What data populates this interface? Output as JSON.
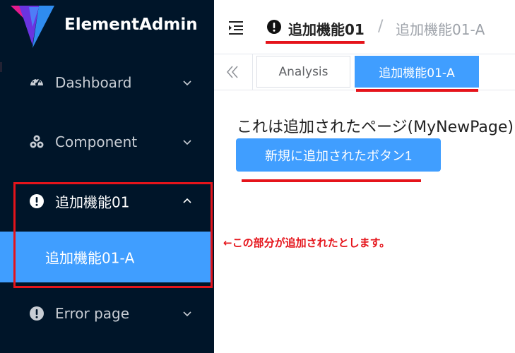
{
  "app": {
    "title": "ElementAdmin"
  },
  "sidebar": {
    "items": [
      {
        "label": "Dashboard",
        "icon": "dashboard-icon"
      },
      {
        "label": "Component",
        "icon": "component-icon"
      },
      {
        "label": "追加機能01",
        "icon": "warning-circle-icon",
        "open": true,
        "children": [
          {
            "label": "追加機能01-A",
            "active": true
          }
        ]
      },
      {
        "label": "Error page",
        "icon": "warning-circle-icon"
      }
    ]
  },
  "header": {
    "breadcrumb": {
      "current": "追加機能01",
      "separator": "/",
      "next": "追加機能01-A"
    }
  },
  "tabs": [
    {
      "label": "Analysis",
      "active": false
    },
    {
      "label": "追加機能01-A",
      "active": true
    }
  ],
  "content": {
    "text": "これは追加されたページ(MyNewPage)",
    "button_label": "新規に追加されたボタン1"
  },
  "annotation": "←この部分が追加されたとします。",
  "colors": {
    "sidebar_bg": "#001529",
    "accent": "#409eff",
    "highlight": "#e5141b"
  }
}
